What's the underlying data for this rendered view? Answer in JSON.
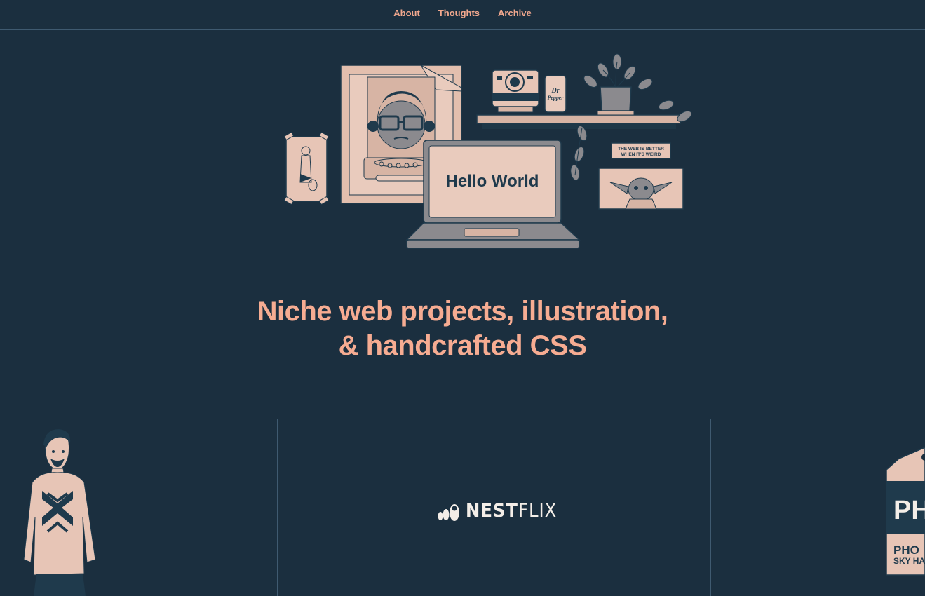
{
  "nav": {
    "items": [
      {
        "label": "About"
      },
      {
        "label": "Thoughts"
      },
      {
        "label": "Archive"
      }
    ]
  },
  "hero": {
    "laptop_screen_text": "Hello World",
    "sign_line1": "THE WEB IS BETTER",
    "sign_line2": "WHEN IT'S WEIRD",
    "soda_label": "Dr Pepper"
  },
  "headline": {
    "line1": "Niche web projects, illustration,",
    "line2": "& handcrafted CSS"
  },
  "projects": {
    "nestflix_bold": "NEST",
    "nestflix_light": "FLIX",
    "tag_big": "PH",
    "tag_line1": "PHO",
    "tag_line2": "SKY HA"
  },
  "colors": {
    "background": "#1b2f3f",
    "accent": "#f6ac92",
    "paper": "#e9c4b4",
    "ink": "#1f3a4c"
  }
}
